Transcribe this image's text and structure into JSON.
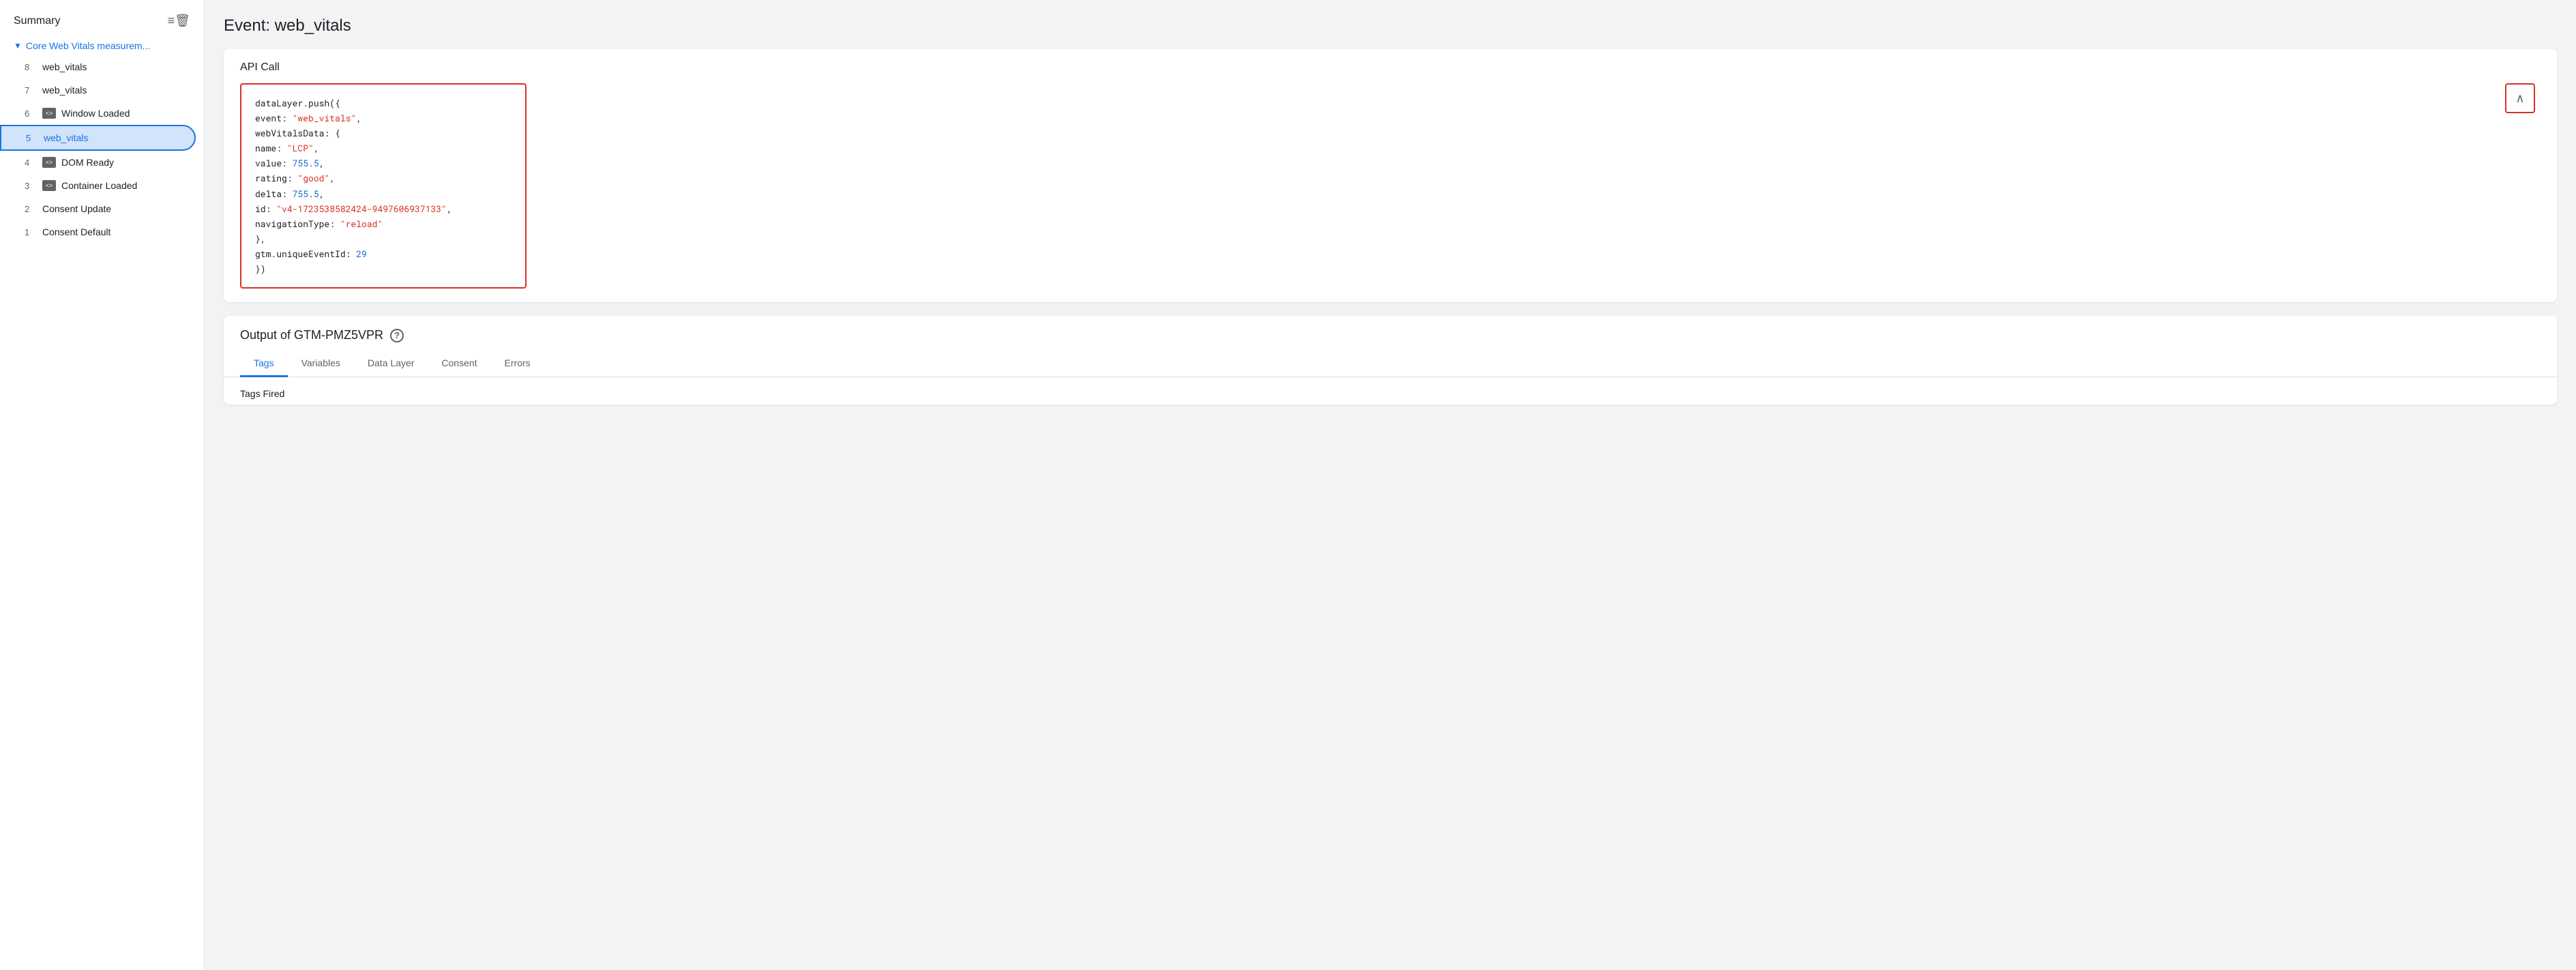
{
  "sidebar": {
    "header_title": "Summary",
    "header_icon": "⊟",
    "section_label": "Core Web Vitals measurem...",
    "items": [
      {
        "num": "8",
        "label": "web_vitals",
        "icon": false,
        "active": false
      },
      {
        "num": "7",
        "label": "web_vitals",
        "icon": false,
        "active": false
      },
      {
        "num": "6",
        "label": "Window Loaded",
        "icon": true,
        "active": false
      },
      {
        "num": "5",
        "label": "web_vitals",
        "icon": false,
        "active": true
      },
      {
        "num": "4",
        "label": "DOM Ready",
        "icon": true,
        "active": false
      },
      {
        "num": "3",
        "label": "Container Loaded",
        "icon": true,
        "active": false
      },
      {
        "num": "2",
        "label": "Consent Update",
        "icon": false,
        "active": false
      },
      {
        "num": "1",
        "label": "Consent Default",
        "icon": false,
        "active": false
      }
    ]
  },
  "page": {
    "title": "Event: web_vitals"
  },
  "api_call": {
    "card_title": "API Call",
    "code_lines": [
      {
        "plain": "dataLayer.push({"
      },
      {
        "plain": "  event: ",
        "string": "\"web_vitals\"",
        "after": ","
      },
      {
        "plain": "  webVitalsData: {"
      },
      {
        "plain": "    name: ",
        "string": "\"LCP\"",
        "after": ","
      },
      {
        "plain": "    value: ",
        "number": "755.5",
        "after": ","
      },
      {
        "plain": "    rating: ",
        "string": "\"good\"",
        "after": ","
      },
      {
        "plain": "    delta: ",
        "number": "755.5",
        "after": ","
      },
      {
        "plain": "    id: ",
        "string": "\"v4-1723538582424-9497606937133\"",
        "after": ","
      },
      {
        "plain": "    navigationType: ",
        "string": "\"reload\""
      },
      {
        "plain": "  },"
      },
      {
        "plain": "  gtm.uniqueEventId: ",
        "number": "29"
      },
      {
        "plain": "})"
      }
    ],
    "expand_icon": "∧"
  },
  "output": {
    "card_title": "Output of GTM-PMZ5VPR",
    "tabs": [
      "Tags",
      "Variables",
      "Data Layer",
      "Consent",
      "Errors"
    ],
    "active_tab": "Tags",
    "section_label": "Tags Fired"
  }
}
